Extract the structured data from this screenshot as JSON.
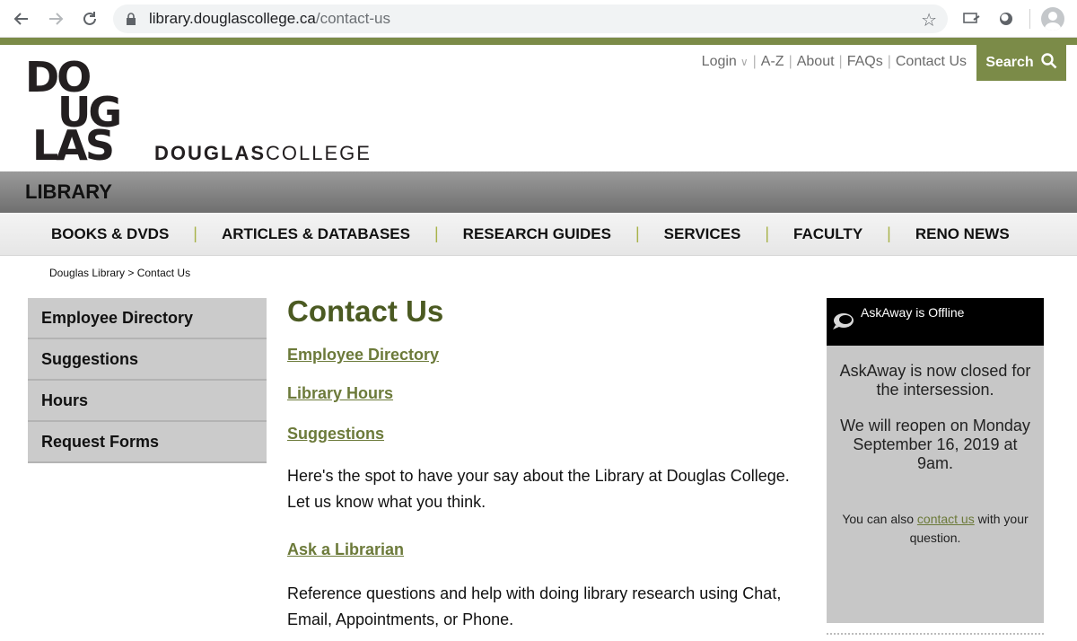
{
  "browser": {
    "url_host": "library.douglascollege.ca",
    "url_path": "/contact-us"
  },
  "header": {
    "logo_text": "DOUGLAS",
    "college_bold": "DOUGLAS",
    "college_light": "COLLEGE",
    "top_links": [
      "Login",
      "A-Z",
      "About",
      "FAQs",
      "Contact Us"
    ],
    "search_label": "Search",
    "library_label": "LIBRARY"
  },
  "nav": {
    "items": [
      "BOOKS & DVDS",
      "ARTICLES & DATABASES",
      "RESEARCH GUIDES",
      "SERVICES",
      "FACULTY",
      "RENO NEWS"
    ],
    "separator": "|"
  },
  "breadcrumb": "Douglas Library > Contact Us",
  "sidebar": {
    "items": [
      "Employee Directory",
      "Suggestions",
      "Hours",
      "Request Forms"
    ]
  },
  "main": {
    "title": "Contact Us",
    "link_employee": "Employee Directory",
    "link_hours": "Library Hours",
    "link_suggestions": "Suggestions",
    "suggestions_text": "Here's the spot to have your say about the Library at Douglas College. Let us know what you think.",
    "link_ask": "Ask a Librarian",
    "ask_text": "Reference questions and help with doing library research using Chat, Email, Appointments, or Phone."
  },
  "chat": {
    "status": "AskAway is Offline",
    "closed_msg": "AskAway is now closed for the intersession.",
    "reopen_msg": "We will reopen on Monday September 16, 2019 at 9am.",
    "contact_prefix": "You can also",
    "contact_link": "contact us",
    "contact_suffix": "with your question."
  },
  "colors": {
    "accent_green": "#7b8b48",
    "heading_green": "#4b5a22",
    "link_green": "#6c7a3a",
    "nav_separator": "#a8b34a"
  }
}
